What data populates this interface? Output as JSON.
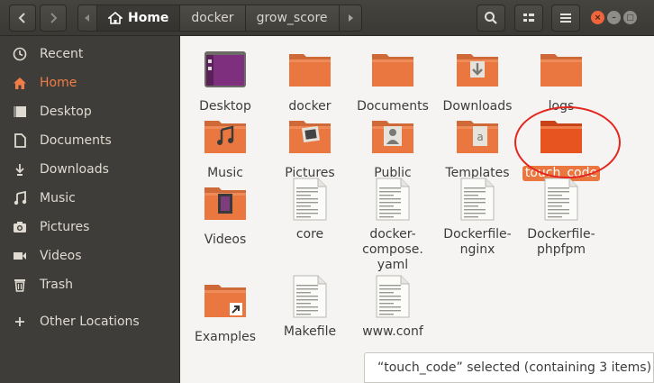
{
  "header": {
    "breadcrumbs": [
      {
        "label": "Home",
        "active": true
      },
      {
        "label": "docker",
        "active": false
      },
      {
        "label": "grow_score",
        "active": false
      }
    ]
  },
  "icons": {
    "back": "chevron-left-icon",
    "forward": "chevron-right-icon",
    "search": "search-icon",
    "view": "view-toggle-icon",
    "menu": "hamburger-menu-icon"
  },
  "sidebar": {
    "items": [
      {
        "label": "Recent",
        "icon": "clock-icon",
        "active": false
      },
      {
        "label": "Home",
        "icon": "home-icon",
        "active": true
      },
      {
        "label": "Desktop",
        "icon": "desktop-icon",
        "active": false
      },
      {
        "label": "Documents",
        "icon": "document-icon",
        "active": false
      },
      {
        "label": "Downloads",
        "icon": "download-icon",
        "active": false
      },
      {
        "label": "Music",
        "icon": "music-icon",
        "active": false
      },
      {
        "label": "Pictures",
        "icon": "camera-icon",
        "active": false
      },
      {
        "label": "Videos",
        "icon": "video-icon",
        "active": false
      },
      {
        "label": "Trash",
        "icon": "trash-icon",
        "active": false
      },
      {
        "label": "Other Locations",
        "icon": "plus-icon",
        "active": false
      }
    ]
  },
  "files": [
    {
      "label": "Desktop",
      "kind": "folder-desktop"
    },
    {
      "label": "docker",
      "kind": "folder"
    },
    {
      "label": "Documents",
      "kind": "folder"
    },
    {
      "label": "Downloads",
      "kind": "folder-downloads"
    },
    {
      "label": "logs",
      "kind": "folder"
    },
    {
      "label": "Music",
      "kind": "folder-music"
    },
    {
      "label": "Pictures",
      "kind": "folder-pictures"
    },
    {
      "label": "Public",
      "kind": "folder-public"
    },
    {
      "label": "Templates",
      "kind": "folder-templates"
    },
    {
      "label": "touch_code",
      "kind": "folder",
      "selected": true
    },
    {
      "label": "Videos",
      "kind": "folder-videos"
    },
    {
      "label": "core",
      "kind": "file"
    },
    {
      "label": "docker-compose.yaml",
      "kind": "file"
    },
    {
      "label": "Dockerfile-nginx",
      "kind": "file"
    },
    {
      "label": "Dockerfile-phpfpm",
      "kind": "file"
    },
    {
      "label": "Examples",
      "kind": "folder-link"
    },
    {
      "label": "Makefile",
      "kind": "file"
    },
    {
      "label": "www.conf",
      "kind": "file"
    }
  ],
  "status": {
    "text": "“touch_code” selected  (containing 3 items)"
  },
  "colors": {
    "accent": "#e9773f",
    "highlight": "#e3261e"
  }
}
